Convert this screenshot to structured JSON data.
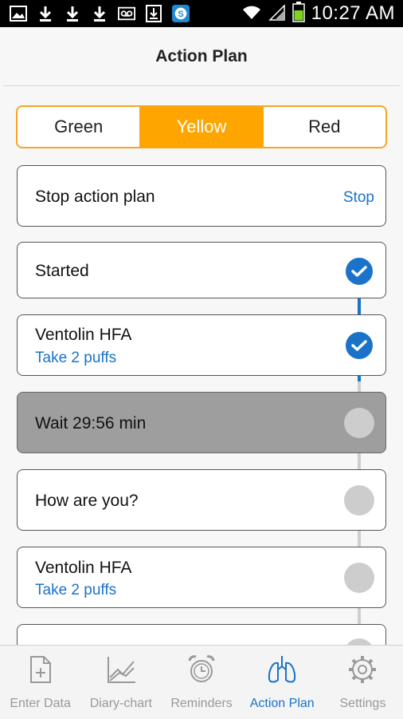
{
  "status_bar": {
    "time": "10:27 AM",
    "left_icons": [
      "image-icon",
      "download-icon",
      "download-icon",
      "download-icon",
      "voicemail-icon",
      "download-box-icon",
      "skype-icon"
    ],
    "right_icons": [
      "wifi-icon",
      "signal-icon",
      "battery-icon"
    ]
  },
  "header": {
    "title": "Action Plan"
  },
  "zones": {
    "items": [
      {
        "label": "Green"
      },
      {
        "label": "Yellow"
      },
      {
        "label": "Red"
      }
    ],
    "selected": "Yellow"
  },
  "stop_card": {
    "label": "Stop action plan",
    "action": "Stop"
  },
  "steps": [
    {
      "title": "Started",
      "subtitle": "",
      "state": "done"
    },
    {
      "title": "Ventolin HFA",
      "subtitle": "Take 2 puffs",
      "state": "done"
    },
    {
      "title": "Wait 29:56 min",
      "subtitle": "",
      "state": "current"
    },
    {
      "title": "How are you?",
      "subtitle": "",
      "state": "pending"
    },
    {
      "title": "Ventolin HFA",
      "subtitle": "Take 2 puffs",
      "state": "pending"
    }
  ],
  "bottom_nav": {
    "tabs": [
      {
        "label": "Enter Data",
        "icon": "document-add-icon"
      },
      {
        "label": "Diary-chart",
        "icon": "chart-icon"
      },
      {
        "label": "Reminders",
        "icon": "alarm-clock-icon"
      },
      {
        "label": "Action Plan",
        "icon": "lungs-icon"
      },
      {
        "label": "Settings",
        "icon": "gear-icon"
      }
    ],
    "active": "Action Plan"
  },
  "colors": {
    "accent": "#ffa500",
    "link": "#1a73c8",
    "progress": "#1a73c8",
    "pending": "#cdcdcd",
    "current_card": "#9e9e9e"
  }
}
